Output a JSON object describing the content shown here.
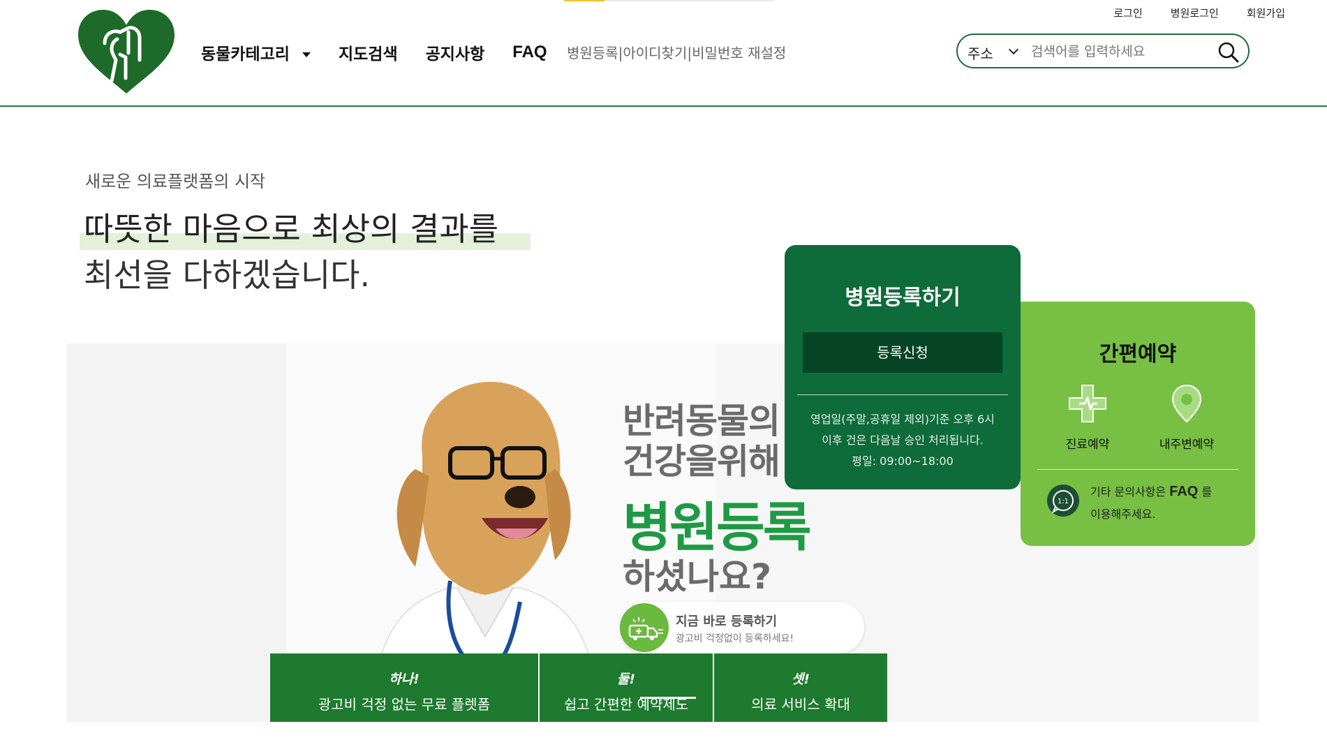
{
  "header": {
    "top_links": [
      "로그인",
      "병원로그인",
      "회원가입"
    ],
    "nav": {
      "category": "동물카테고리",
      "map_search": "지도검색",
      "notice": "공지사항",
      "faq": "FAQ"
    },
    "subnav": [
      "병원등록",
      "|",
      "아이디찾기",
      "|",
      "비밀번호 재설정"
    ],
    "search": {
      "select_value": "주소",
      "placeholder": "검색어를 입력하세요"
    }
  },
  "hero": {
    "subtitle": "새로운 의료플랫폼의 시작",
    "headline_line1": "따뜻한 마음으로 최상의 결과를",
    "headline_line2": "최선을 다하겠습니다."
  },
  "banner": {
    "line1": "반려동물의",
    "line2": "건강을위해",
    "line3": "병원등록",
    "line4": "하셨나요?",
    "badge_title": "지금 바로 등록하기",
    "badge_sub": "광고비 걱정없이 등록하세요!",
    "features": [
      {
        "num": "하나!",
        "desc": "광고비 걱정 없는 무료 플렛폼"
      },
      {
        "num": "둘!",
        "desc": "쉽고 간편한 예약제도"
      },
      {
        "num": "셋!",
        "desc": "의료 서비스 확대"
      }
    ]
  },
  "register_card": {
    "title": "병원등록하기",
    "button": "등록신청",
    "info1": "영업일(주말,공휴일 제외)기준 오후 6시",
    "info2": "이후 건은 다음날 승인 처리됩니다.",
    "info3": "평일: 09:00~18:00"
  },
  "easy_card": {
    "title": "간편예약",
    "opt1": "진료예약",
    "opt2": "내주변예약",
    "faq_pre": "기타 문의사항은",
    "faq_bold": "FAQ",
    "faq_post": "를",
    "faq_line2": "이용해주세요.",
    "chat_label": "1:1"
  },
  "colors": {
    "brand_green": "#1e7a3c",
    "dark_green": "#0e6b3a",
    "light_green": "#77c043",
    "banner_green": "#1f9a44"
  }
}
